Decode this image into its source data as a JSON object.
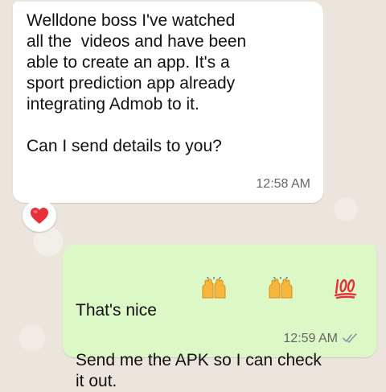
{
  "incoming": {
    "lines": [
      "Welldone boss I've watched",
      "all the  videos and have been",
      "able to create an app. It's a",
      "sport prediction app already",
      "integrating Admob to it."
    ],
    "question": "Can I send details to you?",
    "time": "12:58 AM",
    "reaction": "heart-icon"
  },
  "outgoing": {
    "line1": "That's nice",
    "emojis": [
      "raised-hands-icon",
      "raised-hands-icon",
      "hundred-points-icon"
    ],
    "line2": "Send me the APK so I can check",
    "line3": "it out.",
    "time": "12:59 AM",
    "status": "read-double-check-icon"
  },
  "colors": {
    "background": "#ece5dd",
    "incoming_bubble": "#ffffff",
    "outgoing_bubble": "#dcf8c6",
    "read_ticks": "#8696a0",
    "heart": "#e8303b"
  }
}
